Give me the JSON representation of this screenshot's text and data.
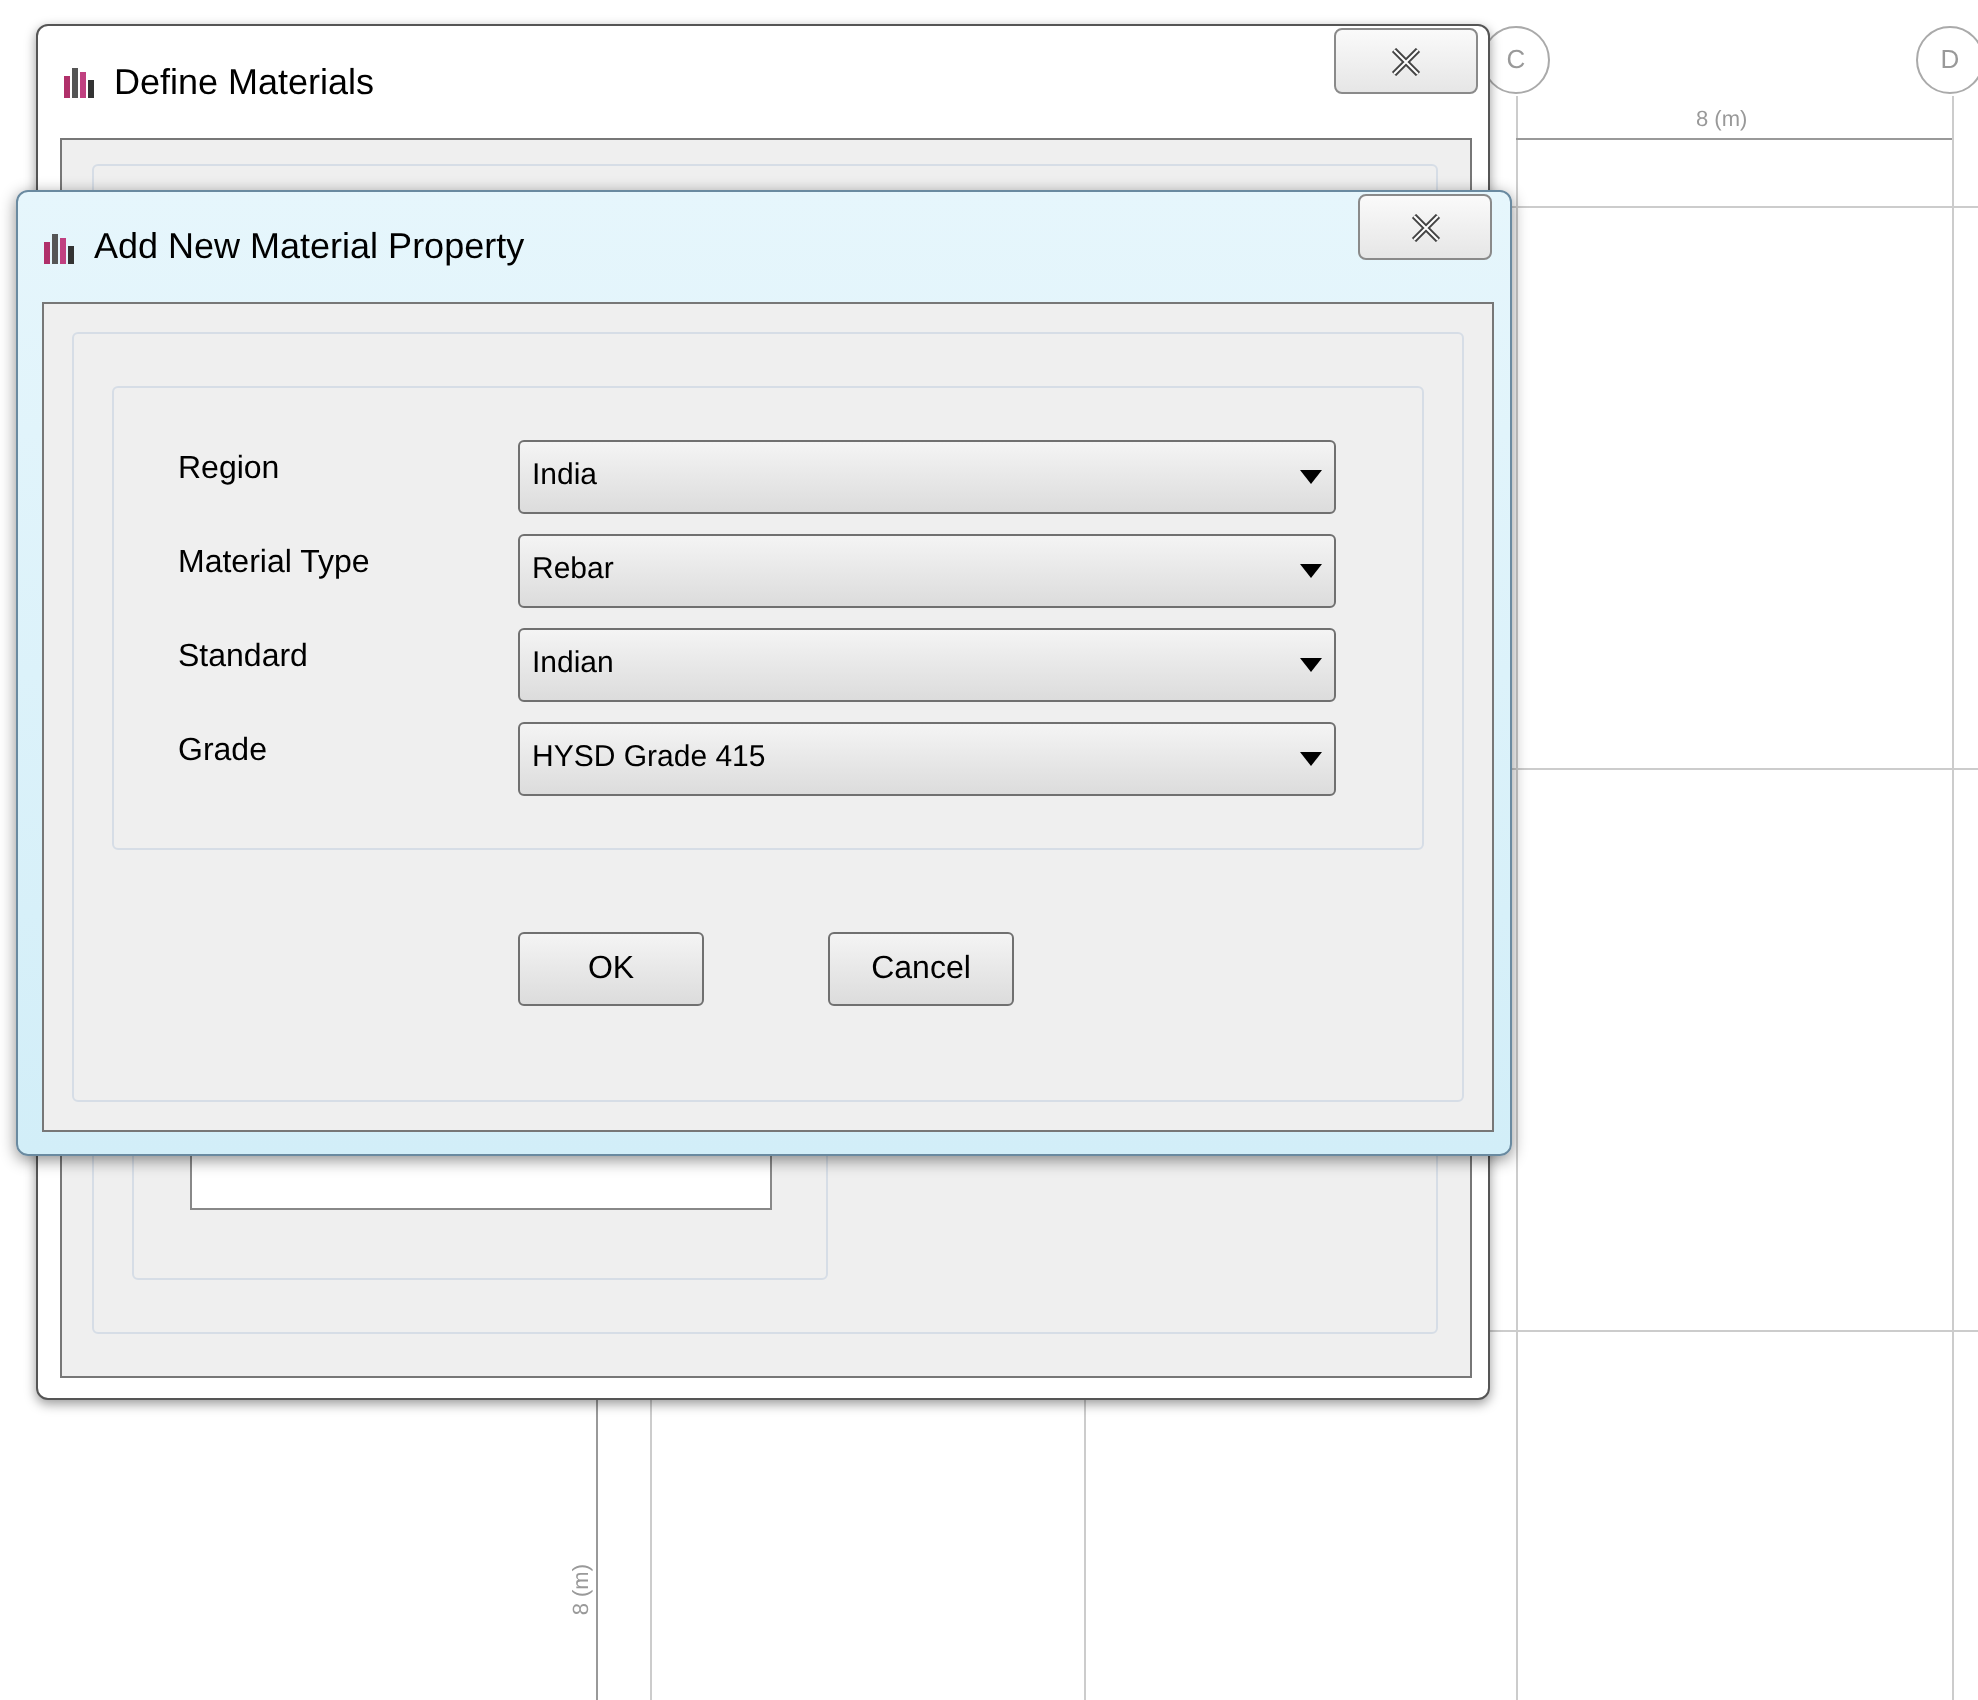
{
  "canvas": {
    "grid_bubbles": [
      "C",
      "D"
    ],
    "horizontal_dimension": "8 (m)",
    "vertical_dimension": "8 (m)"
  },
  "define_materials": {
    "title": "Define Materials"
  },
  "add_material_dialog": {
    "title": "Add New Material Property",
    "fields": [
      {
        "label": "Region",
        "value": "India"
      },
      {
        "label": "Material Type",
        "value": "Rebar"
      },
      {
        "label": "Standard",
        "value": "Indian"
      },
      {
        "label": "Grade",
        "value": "HYSD Grade 415"
      }
    ],
    "buttons": [
      "OK",
      "Cancel"
    ]
  }
}
